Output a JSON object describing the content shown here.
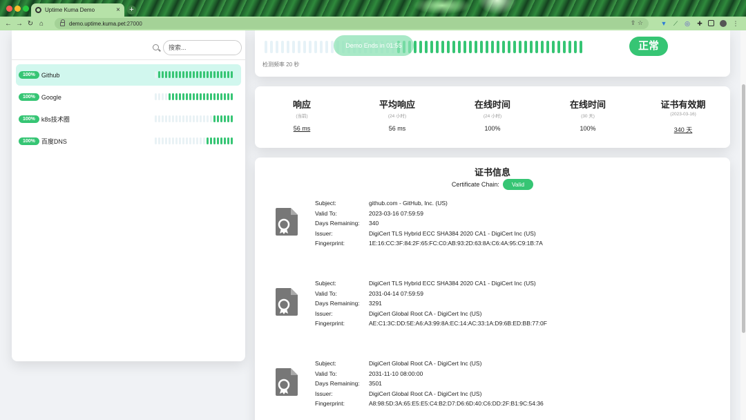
{
  "browser": {
    "tab_title": "Uptime Kuma Demo",
    "tab_close": "×",
    "new_tab": "+",
    "url_host": "demo.uptime.kuma.pet",
    "url_port": ":27000",
    "nav": {
      "back": "←",
      "forward": "→",
      "reload": "↻",
      "home": "⌂"
    },
    "omni_actions": "⇪  ☆"
  },
  "sidebar": {
    "search_placeholder": "搜索...",
    "monitors": [
      {
        "uptime": "100%",
        "name": "Github",
        "active": true,
        "beats_filled": 22,
        "beats_total": 23
      },
      {
        "uptime": "100%",
        "name": "Google",
        "active": false,
        "beats_filled": 19,
        "beats_total": 23
      },
      {
        "uptime": "100%",
        "name": "k8s技术圈",
        "active": false,
        "beats_filled": 6,
        "beats_total": 23
      },
      {
        "uptime": "100%",
        "name": "百度DNS",
        "active": false,
        "beats_filled": 8,
        "beats_total": 23
      }
    ]
  },
  "status": {
    "beats_empty": 24,
    "beats_filled": 34,
    "demo_text": "Demo Ends in 01:55",
    "badge": "正常",
    "interval": "检测频率 20 秒"
  },
  "stats": [
    {
      "title": "响应",
      "sub": "(当前)",
      "value": "56 ms",
      "link": true
    },
    {
      "title": "平均响应",
      "sub": "(24 小时)",
      "value": "56 ms",
      "link": false
    },
    {
      "title": "在线时间",
      "sub": "(24 小时)",
      "value": "100%",
      "link": false
    },
    {
      "title": "在线时间",
      "sub": "(30 天)",
      "value": "100%",
      "link": false
    },
    {
      "title": "证书有效期",
      "sub": "(2023-03-16)",
      "value": "340 天",
      "link": true
    }
  ],
  "certificate": {
    "title": "证书信息",
    "chain_label": "Certificate Chain:",
    "chain_status": "Valid",
    "labels": {
      "subject": "Subject:",
      "valid_to": "Valid To:",
      "days": "Days Remaining:",
      "issuer": "Issuer:",
      "fingerprint": "Fingerprint:"
    },
    "chain": [
      {
        "subject": "github.com - GitHub, Inc. (US)",
        "valid_to": "2023-03-16 07:59:59",
        "days": "340",
        "issuer": "DigiCert TLS Hybrid ECC SHA384 2020 CA1 - DigiCert Inc (US)",
        "fingerprint": "1E:16:CC:3F:84:2F:65:FC:C0:AB:93:2D:63:8A:C6:4A:95:C9:1B:7A"
      },
      {
        "subject": "DigiCert TLS Hybrid ECC SHA384 2020 CA1 - DigiCert Inc (US)",
        "valid_to": "2031-04-14 07:59:59",
        "days": "3291",
        "issuer": "DigiCert Global Root CA - DigiCert Inc (US)",
        "fingerprint": "AE:C1:3C:DD:5E:A6:A3:99:8A:EC:14:AC:33:1A:D9:6B:ED:BB:77:0F"
      },
      {
        "subject": "DigiCert Global Root CA - DigiCert Inc (US)",
        "valid_to": "2031-11-10 08:00:00",
        "days": "3501",
        "issuer": "DigiCert Global Root CA - DigiCert Inc (US)",
        "fingerprint": "A8:98:5D:3A:65:E5:E5:C4:B2:D7:D6:6D:40:C6:DD:2F:B1:9C:54:36"
      }
    ]
  },
  "colors": {
    "accent": "#36c574",
    "active_row": "#d1f7ee",
    "empty_beat": "#e9f2f5"
  },
  "icons": [
    "search-icon",
    "certificate-icon",
    "link-icon",
    "lock-icon"
  ]
}
